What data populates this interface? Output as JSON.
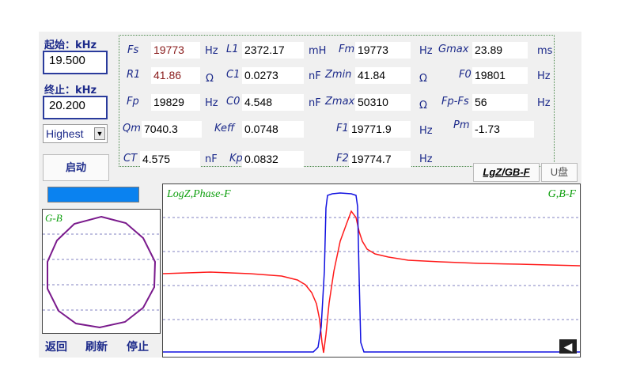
{
  "controls": {
    "start_label": "起始：kHz",
    "start_value": "19.500",
    "stop_label": "终止：kHz",
    "stop_value": "20.200",
    "mode_value": "Highest",
    "start_button": "启动"
  },
  "params": {
    "Fs": {
      "name": "Fs",
      "value": "19773",
      "unit": "Hz"
    },
    "L1": {
      "name": "L1",
      "value": "2372.17",
      "unit": "mH"
    },
    "Fm": {
      "name": "Fm",
      "value": "19773",
      "unit": "Hz"
    },
    "Gmax": {
      "name": "Gmax",
      "value": "23.89",
      "unit": "ms"
    },
    "R1": {
      "name": "R1",
      "value": "41.86",
      "unit": "Ω"
    },
    "C1": {
      "name": "C1",
      "value": "0.0273",
      "unit": "nF"
    },
    "Zmin": {
      "name": "Zmin",
      "value": "41.84",
      "unit": "Ω"
    },
    "F0": {
      "name": "F0",
      "value": "19801",
      "unit": "Hz"
    },
    "Fp": {
      "name": "Fp",
      "value": "19829",
      "unit": "Hz"
    },
    "C0": {
      "name": "C0",
      "value": "4.548",
      "unit": "nF"
    },
    "Zmax": {
      "name": "Zmax",
      "value": "50310",
      "unit": "Ω"
    },
    "FpFs": {
      "name": "Fp-Fs",
      "value": "56",
      "unit": "Hz"
    },
    "Qm": {
      "name": "Qm",
      "value": "7040.3"
    },
    "Keff": {
      "name": "Keff",
      "value": "0.0748"
    },
    "F1": {
      "name": "F1",
      "value": "19771.9",
      "unit": "Hz"
    },
    "Pm": {
      "name": "Pm",
      "value": "-1.73"
    },
    "CT": {
      "name": "CT",
      "value": "4.575",
      "unit": "nF"
    },
    "Kp": {
      "name": "Kp",
      "value": "0.0832"
    },
    "F2": {
      "name": "F2",
      "value": "19774.7",
      "unit": "Hz"
    }
  },
  "buttons": {
    "lgz_gbf": "LgZ/GB-F",
    "usb": "U盘"
  },
  "charts": {
    "left_label": "G-B",
    "main_left_label": "LogZ,Phase-F",
    "main_right_label": "G,B-F"
  },
  "bottom": {
    "back": "返回",
    "refresh": "刷新",
    "stop": "停止"
  },
  "colors": {
    "accent_blue": "#0a82f0",
    "trace_red": "#ff1a1a",
    "trace_blue": "#1010e0",
    "circle_purple": "#7a1a8c"
  }
}
